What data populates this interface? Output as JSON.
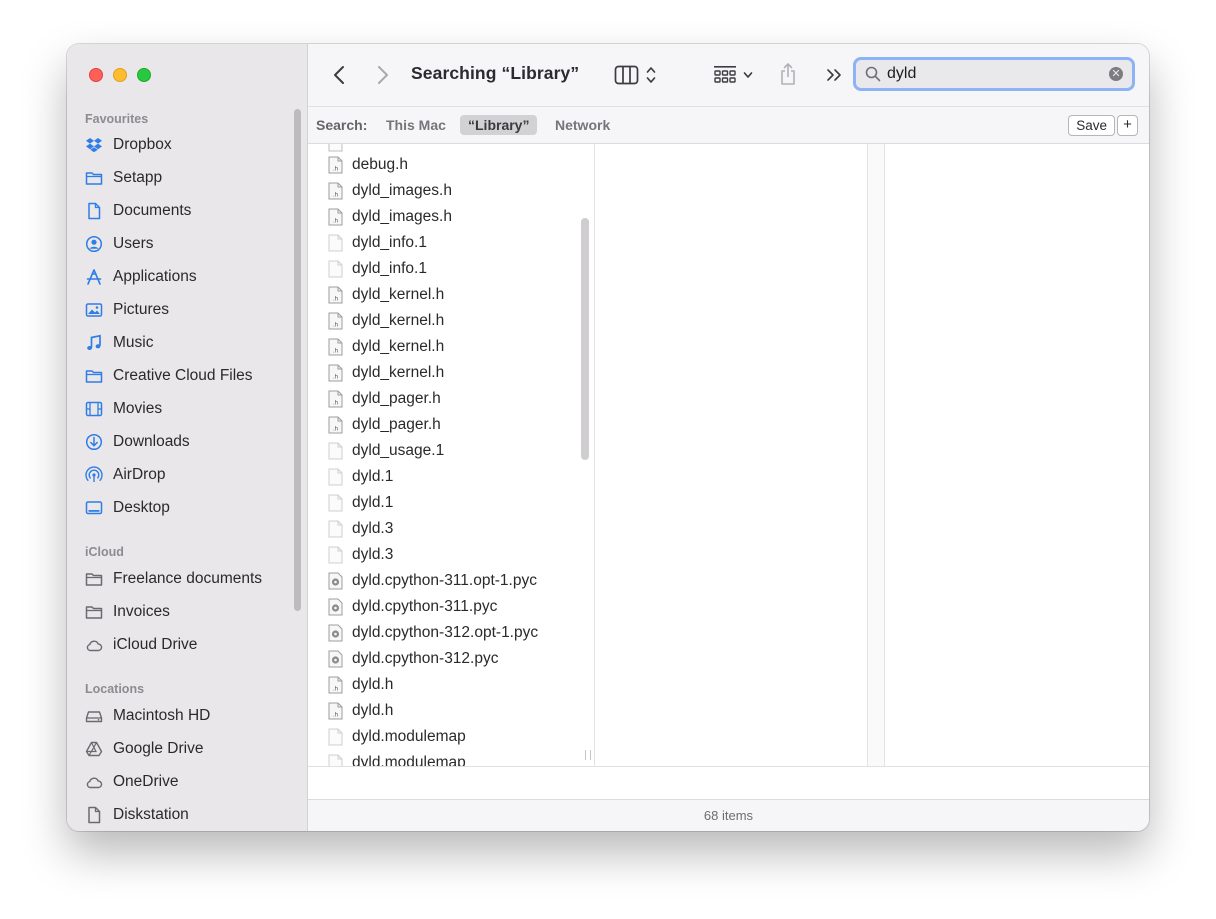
{
  "toolbar": {
    "title": "Searching “Library”",
    "search_value": "dyld"
  },
  "scope": {
    "label": "Search:",
    "options": [
      "This Mac",
      "“Library”",
      "Network"
    ],
    "selected": "“Library”",
    "save_label": "Save",
    "add_label": "+"
  },
  "sidebar": {
    "favourites_title": "Favourites",
    "favourites": [
      {
        "label": "Dropbox",
        "icon": "dropbox-icon"
      },
      {
        "label": "Setapp",
        "icon": "folder-icon"
      },
      {
        "label": "Documents",
        "icon": "document-icon"
      },
      {
        "label": "Users",
        "icon": "user-icon"
      },
      {
        "label": "Applications",
        "icon": "applications-icon"
      },
      {
        "label": "Pictures",
        "icon": "pictures-icon"
      },
      {
        "label": "Music",
        "icon": "music-icon"
      },
      {
        "label": "Creative Cloud Files",
        "icon": "folder-icon"
      },
      {
        "label": "Movies",
        "icon": "film-icon"
      },
      {
        "label": "Downloads",
        "icon": "download-icon"
      },
      {
        "label": "AirDrop",
        "icon": "airdrop-icon"
      },
      {
        "label": "Desktop",
        "icon": "desktop-icon"
      }
    ],
    "icloud_title": "iCloud",
    "icloud": [
      {
        "label": "Freelance documents",
        "icon": "folder-icon"
      },
      {
        "label": "Invoices",
        "icon": "folder-icon"
      },
      {
        "label": "iCloud Drive",
        "icon": "cloud-icon"
      }
    ],
    "locations_title": "Locations",
    "locations": [
      {
        "label": "Macintosh HD",
        "icon": "drive-icon"
      },
      {
        "label": "Google Drive",
        "icon": "google-drive-icon"
      },
      {
        "label": "OneDrive",
        "icon": "cloud-icon"
      },
      {
        "label": "Diskstation",
        "icon": "document-icon"
      }
    ]
  },
  "files": [
    {
      "name": "debug.h",
      "type": "h"
    },
    {
      "name": "dyld_images.h",
      "type": "h"
    },
    {
      "name": "dyld_images.h",
      "type": "h"
    },
    {
      "name": "dyld_info.1",
      "type": "plain"
    },
    {
      "name": "dyld_info.1",
      "type": "plain"
    },
    {
      "name": "dyld_kernel.h",
      "type": "h"
    },
    {
      "name": "dyld_kernel.h",
      "type": "h"
    },
    {
      "name": "dyld_kernel.h",
      "type": "h"
    },
    {
      "name": "dyld_kernel.h",
      "type": "h"
    },
    {
      "name": "dyld_pager.h",
      "type": "h"
    },
    {
      "name": "dyld_pager.h",
      "type": "h"
    },
    {
      "name": "dyld_usage.1",
      "type": "plain"
    },
    {
      "name": "dyld.1",
      "type": "plain"
    },
    {
      "name": "dyld.1",
      "type": "plain"
    },
    {
      "name": "dyld.3",
      "type": "plain"
    },
    {
      "name": "dyld.3",
      "type": "plain"
    },
    {
      "name": "dyld.cpython-311.opt-1.pyc",
      "type": "pyc"
    },
    {
      "name": "dyld.cpython-311.pyc",
      "type": "pyc"
    },
    {
      "name": "dyld.cpython-312.opt-1.pyc",
      "type": "pyc"
    },
    {
      "name": "dyld.cpython-312.pyc",
      "type": "pyc"
    },
    {
      "name": "dyld.h",
      "type": "h"
    },
    {
      "name": "dyld.h",
      "type": "h"
    },
    {
      "name": "dyld.modulemap",
      "type": "plain"
    },
    {
      "name": "dyld.modulemap",
      "type": "plain"
    }
  ],
  "status": {
    "item_count": "68 items"
  }
}
